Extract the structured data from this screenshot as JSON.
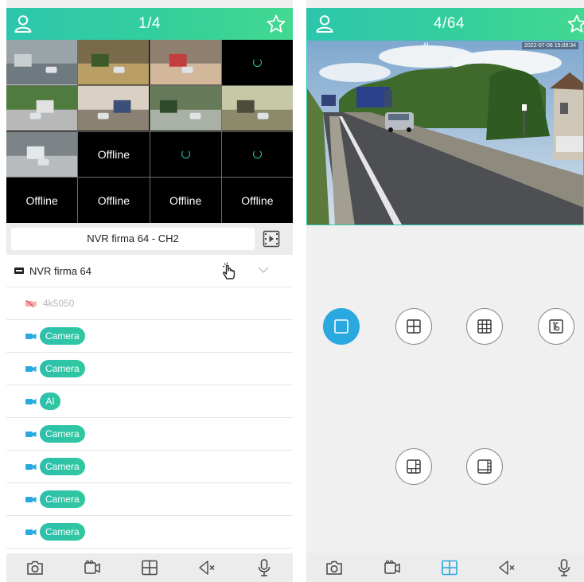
{
  "left": {
    "header": {
      "title": "1/4"
    },
    "grid": {
      "tiles": [
        {
          "kind": "image"
        },
        {
          "kind": "image"
        },
        {
          "kind": "image"
        },
        {
          "kind": "loading"
        },
        {
          "kind": "image"
        },
        {
          "kind": "image"
        },
        {
          "kind": "image"
        },
        {
          "kind": "image"
        },
        {
          "kind": "image"
        },
        {
          "kind": "offline",
          "label": "Offline"
        },
        {
          "kind": "loading"
        },
        {
          "kind": "loading"
        },
        {
          "kind": "offline",
          "label": "Offline"
        },
        {
          "kind": "offline",
          "label": "Offline"
        },
        {
          "kind": "offline",
          "label": "Offline"
        },
        {
          "kind": "offline",
          "label": "Offline"
        }
      ]
    },
    "channel_name": "NVR firma 64 - CH2",
    "device_list": {
      "device": "NVR firma 64",
      "offline_channel": "4k5050",
      "channels": [
        "Camera",
        "Camera",
        "AI",
        "Camera",
        "Camera",
        "Camera",
        "Camera"
      ]
    }
  },
  "right": {
    "header": {
      "title": "4/64"
    },
    "preview": {
      "timestamp": "2022-07-06 15:09:34",
      "label": "AI"
    }
  },
  "colors": {
    "header_gradient_start": "#2dc6ad",
    "header_gradient_end": "#42d98f",
    "active_blue": "#2aa8e0",
    "accent_teal": "#2dc6ad"
  },
  "icons": {
    "header_left": "user-icon",
    "header_right": "star-icon",
    "toolbar": [
      "camera-snapshot-icon",
      "video-record-icon",
      "layout-grid-icon",
      "speaker-muted-icon",
      "microphone-icon"
    ],
    "layout_buttons": [
      "layout-1-icon",
      "layout-4-icon",
      "layout-9-icon",
      "layout-16-icon",
      "layout-6-icon",
      "layout-8-icon"
    ]
  }
}
